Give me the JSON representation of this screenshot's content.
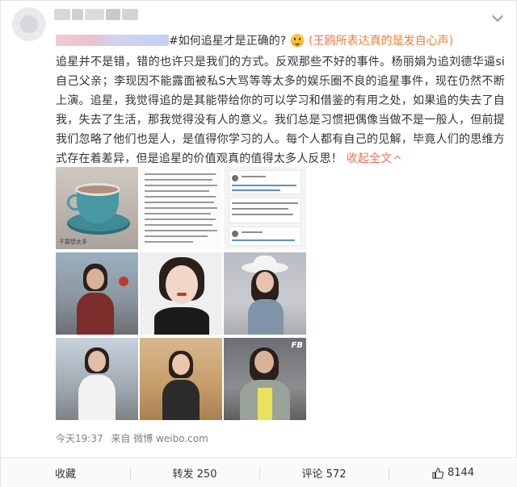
{
  "post": {
    "topic_prefix_blurred": "",
    "topic": "#如何追星才是正确的?",
    "paren_open": "(",
    "mention": "王鸥",
    "after_mention": "所表达真的是发自心声)",
    "body": "追星并不是错，错的也许只是我们的方式。反观那些不好的事件。杨丽娟为追刘德华逼si自己父亲；李现因不能露面被私S大骂等等太多的娱乐圈不良的追星事件，现在仍然不断上演。追星，我觉得追的是其能带给你的可以学习和借鉴的有用之处，如果追的失去了自我，失去了生活，那我觉得没有人的意义。我们总是习惯把偶像当做不是一般人，但前提我们忽略了他们也是人，是值得你学习的人。每个人都有自己的见解，毕竟人们的思维方式存在着差异，但是追星的价值观真的值得太多人反思！",
    "collapse_label": "收起全文",
    "time": "今天19:37",
    "source": "来自 微博 weibo.com"
  },
  "images": {
    "cup_caption": "不要想太多",
    "photo9_logo": "FB"
  },
  "actions": {
    "favorite": "收藏",
    "repost": "转发 250",
    "comment": "评论 572",
    "like": "8144"
  },
  "colors": {
    "accent": "#eb7350",
    "mention_orange": "#f07f37"
  }
}
